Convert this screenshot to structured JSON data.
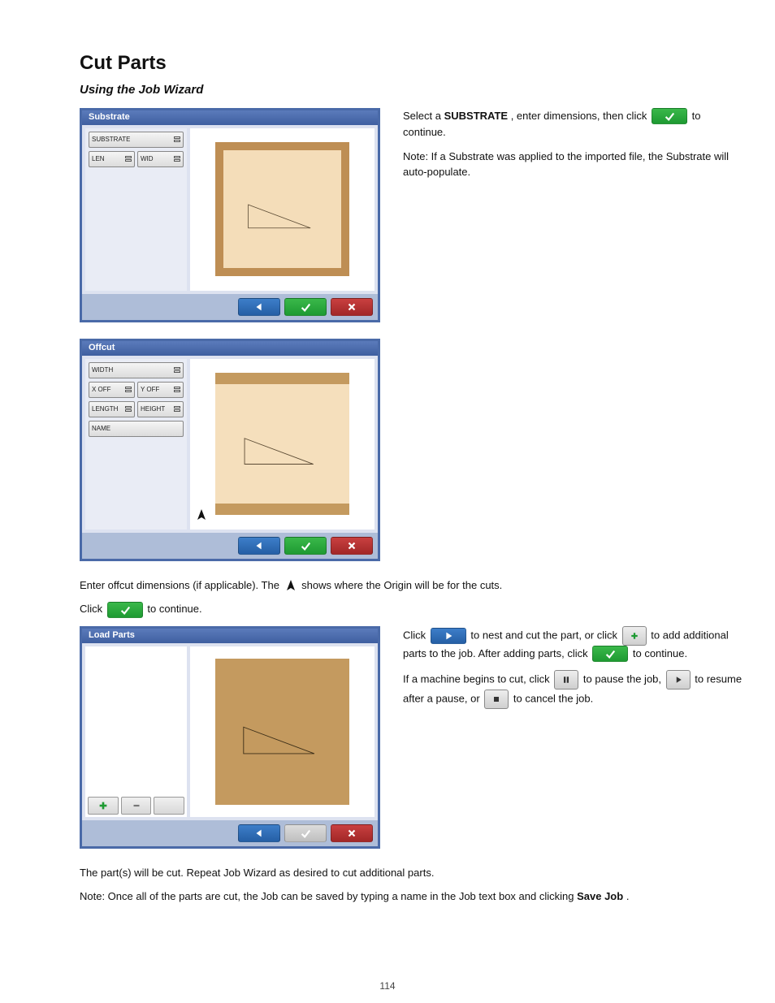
{
  "page": {
    "title": "Cut Parts",
    "subtitle": "Using the Job Wizard",
    "number": "114"
  },
  "dialog1": {
    "title": "Substrate",
    "fields": {
      "substrate": "SUBSTRATE",
      "length": "LEN",
      "width": "WID"
    }
  },
  "dialog2": {
    "title": "Offcut",
    "fields": {
      "width": "WIDTH",
      "xoff": "X OFF",
      "yoff": "Y OFF",
      "length": "LENGTH",
      "height": "HEIGHT",
      "name": "NAME"
    }
  },
  "dialog3": {
    "title": "Load Parts"
  },
  "step6": {
    "p1_a": "Select a ",
    "p1_b": ", enter dimensions, then click ",
    "p1_c": " to continue.",
    "key": "SUBSTRATE",
    "p2": "Note: If a Substrate was applied to the imported file, the Substrate will auto-populate."
  },
  "step7": {
    "p1_a": "Enter offcut dimensions (if applicable). The ",
    "p1_b": " shows where the Origin will be for the cuts.",
    "p2_a": "Click ",
    "p2_b": " to continue."
  },
  "step8": {
    "p1_a": "Click ",
    "p1_b": " to nest and cut the part, or click ",
    "p1_c": " to add additional parts to the job. After adding parts, click ",
    "p1_d": " to continue.",
    "p2_a": "If a machine begins to cut, click ",
    "p2_b": " to pause the job, ",
    "p2_c": " to resume after a pause, or ",
    "p2_d": " to cancel the job."
  },
  "foot": {
    "p1": "The part(s) will be cut. Repeat Job Wizard as desired to cut additional parts.",
    "p2_a": "Note: Once all of the parts are cut, the Job can be saved by typing a name in the Job text box and clicking ",
    "p2_key": "Save Job",
    "p2_b": "."
  }
}
